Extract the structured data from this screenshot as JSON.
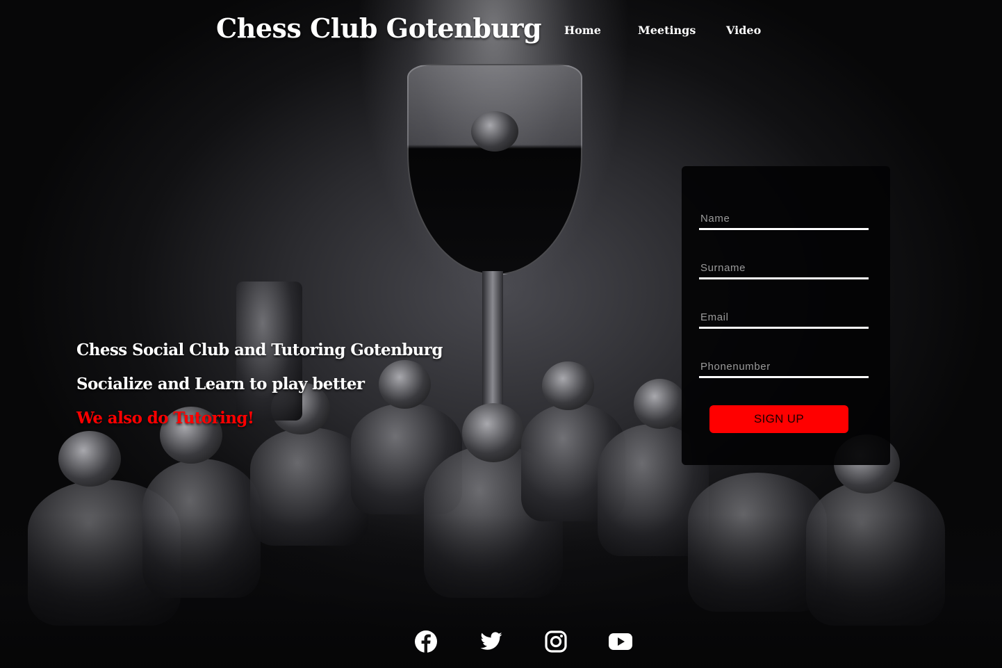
{
  "header": {
    "title": "Chess Club Gotenburg",
    "nav": [
      {
        "label": "Home"
      },
      {
        "label": "Meetings"
      },
      {
        "label": "Video"
      }
    ]
  },
  "hero": {
    "line1": "Chess Social Club and Tutoring Gotenburg",
    "line2": "Socialize and Learn to play better",
    "line3": "We also do Tutoring!"
  },
  "signup": {
    "name_placeholder": "Name",
    "surname_placeholder": "Surname",
    "email_placeholder": "Email",
    "phone_placeholder": "Phonenumber",
    "button_label": "SIGN UP"
  },
  "social": [
    {
      "icon": "facebook-icon"
    },
    {
      "icon": "twitter-icon"
    },
    {
      "icon": "instagram-icon"
    },
    {
      "icon": "youtube-icon"
    }
  ],
  "colors": {
    "accent": "#ff0000",
    "text": "#ffffff",
    "panel": "#030304"
  }
}
